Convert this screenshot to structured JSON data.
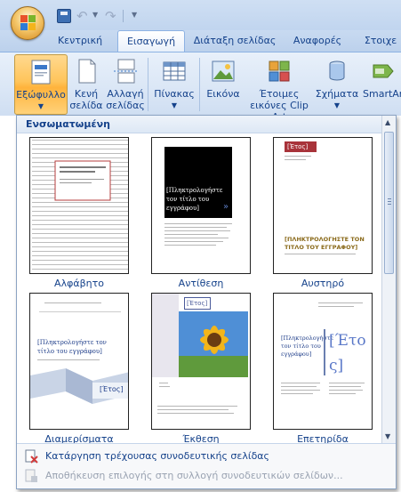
{
  "ribbon_tabs": [
    "Κεντρική",
    "Εισαγωγή",
    "Διάταξη σελίδας",
    "Αναφορές",
    "Στοιχε"
  ],
  "active_tab": "Εισαγωγή",
  "ribbon_buttons": {
    "cover": "Εξώφυλλο",
    "blank_page_l1": "Κενή",
    "blank_page_l2": "σελίδα",
    "page_break_l1": "Αλλαγή",
    "page_break_l2": "σελίδας",
    "tables": "Πίνακας",
    "picture": "Εικόνα",
    "clipart_l1": "Έτοιμες",
    "clipart_l2": "εικόνες Clip Art",
    "shapes": "Σχήματα",
    "smartart": "SmartArt"
  },
  "gallery": {
    "header": "Ενσωματωμένη",
    "items": [
      {
        "caption": "Αλφάβητο"
      },
      {
        "caption": "Αντίθεση",
        "title_text": "[Πληκτρολογήστε τον τίτλο του εγγράφου]"
      },
      {
        "caption": "Αυστηρό",
        "title_text": "[ΠΛΗΚΤΡΟΛΟΓΗΣΤΕ ΤΟΝ ΤΙΤΛΟ ΤΟΥ ΕΓΓΡΑΦΟΥ]",
        "year": "[Έτος]"
      },
      {
        "caption": "Διαμερίσματα",
        "title_text": "[Πληκτρολογήστε τον τίτλο του εγγράφου]",
        "year": "[Έτος]"
      },
      {
        "caption": "Έκθεση",
        "year": "[Έτος]"
      },
      {
        "caption": "Επετηρίδα",
        "title_text": "[Πληκτρολογήστε τον τίτλο του εγγράφου]",
        "year_l1": "[Έτο",
        "year_l2": "ς]"
      }
    ]
  },
  "footer": {
    "remove_cover": "Κατάργηση τρέχουσας συνοδευτικής σελίδας",
    "save_selection": "Αποθήκευση επιλογής στη συλλογή συνοδευτικών σελίδων..."
  },
  "colors": {
    "accent_blue": "#15428b",
    "ribbon_bg": "#dbe7f6",
    "pressed_orange": "#ffc45a",
    "austiro_red": "#a8333a",
    "austiro_text": "#8a6a1a",
    "ekthesi_blue": "#4a5a9a"
  }
}
